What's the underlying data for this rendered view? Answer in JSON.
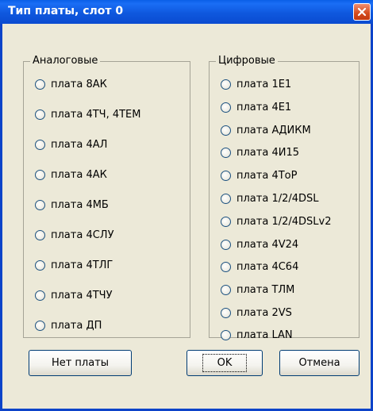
{
  "window": {
    "title": "Тип платы, слот 0"
  },
  "analog": {
    "label": "Аналоговые",
    "items": [
      "плата 8АК",
      "плата 4ТЧ, 4ТЕМ",
      "плата 4АЛ",
      "плата 4АК",
      "плата 4МБ",
      "плата 4СЛУ",
      "плата 4ТЛГ",
      "плата 4ТЧУ",
      "плата ДП"
    ]
  },
  "digital": {
    "label": "Цифровые",
    "items": [
      "плата 1Е1",
      "плата 4Е1",
      "плата АДИКМ",
      "плата 4И15",
      "плата 4ТоР",
      "плата 1/2/4DSL",
      "плата 1/2/4DSLv2",
      "плата 4V24",
      "плата 4С64",
      "плата ТЛМ",
      "плата 2VS",
      "плата LAN"
    ]
  },
  "buttons": {
    "none": "Нет платы",
    "ok": "OK",
    "cancel": "Отмена"
  },
  "icons": {
    "close": "close-icon"
  }
}
